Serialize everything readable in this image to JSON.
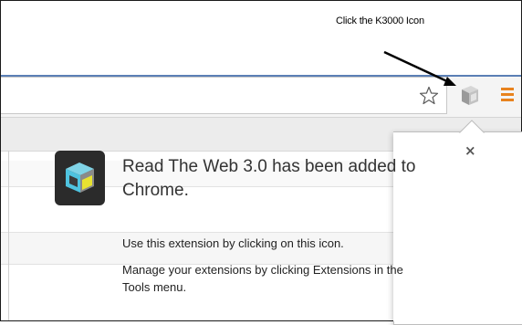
{
  "annotation": {
    "text": "Click the K3000 Icon"
  },
  "toolbar": {
    "star_icon": "star-outline-icon",
    "extension_icon": "read-the-web-extension-icon",
    "menu_icon": "hamburger-menu-icon",
    "menu_color": "#e8831e"
  },
  "popup": {
    "title": "Read The Web 3.0 has been added to Chrome.",
    "line1": "Use this extension by clicking on this icon.",
    "line2": "Manage your extensions by clicking Extensions in the Tools menu.",
    "close_label": "×",
    "icon": "read-the-web-cube-icon"
  },
  "colors": {
    "accent_blue": "#5b7fb5",
    "cube_cyan": "#4fc3df",
    "cube_yellow": "#e8e230",
    "cube_dark": "#2b2b2b"
  }
}
